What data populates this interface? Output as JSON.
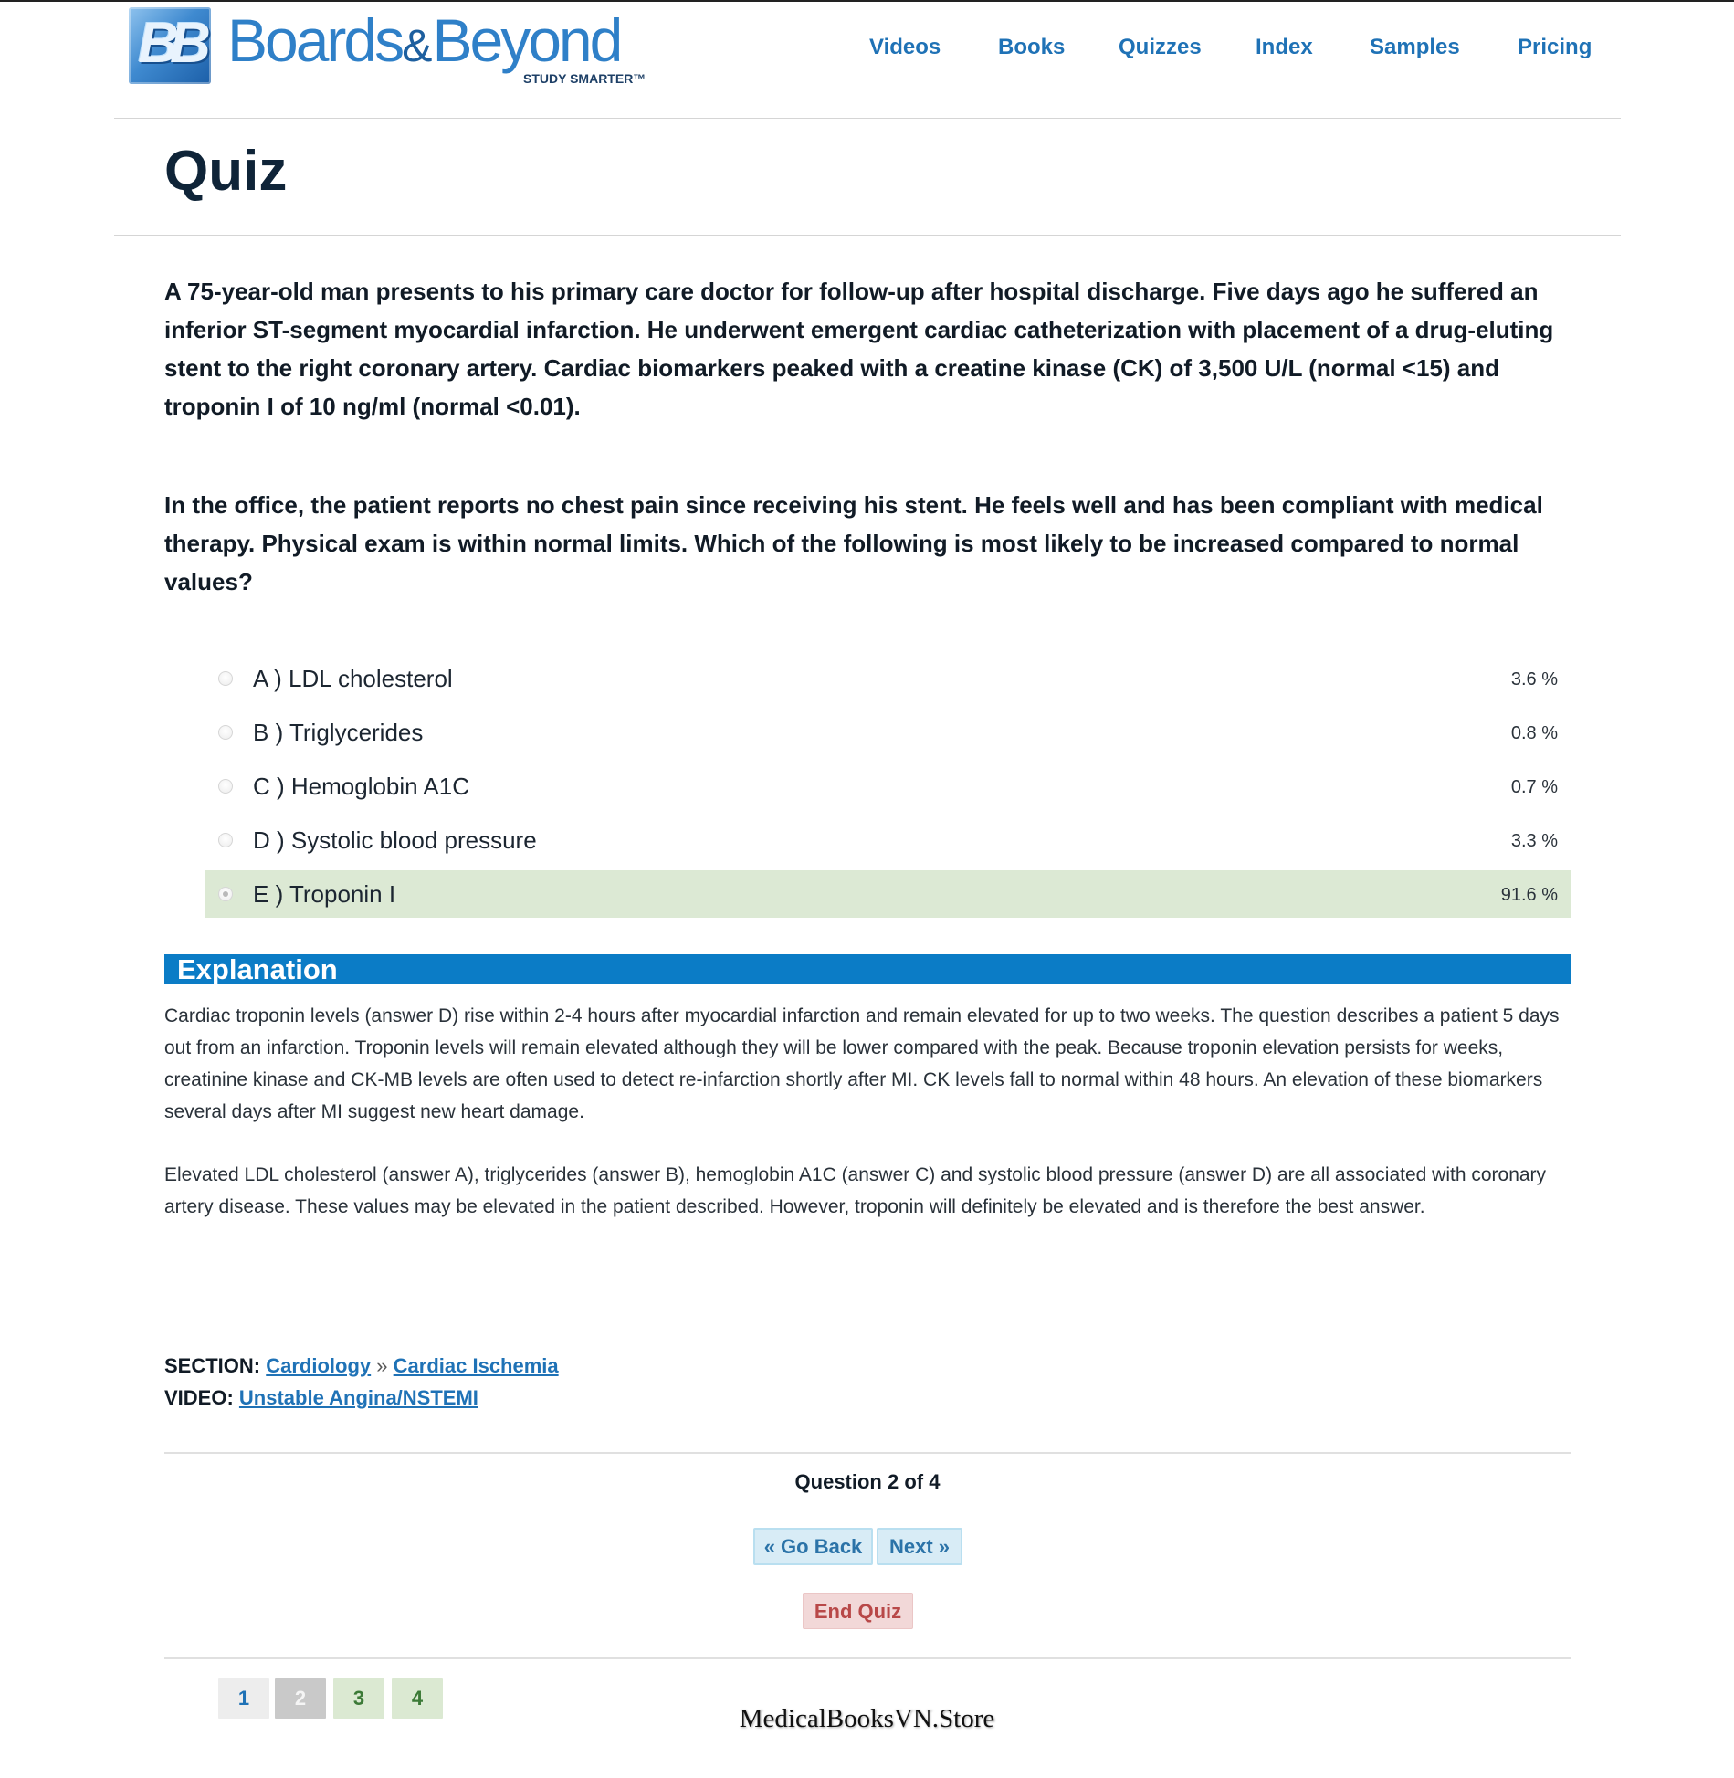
{
  "header": {
    "logo_mark": "BB",
    "logo_word": "Boards",
    "logo_amp": "&",
    "logo_word2": "Beyond",
    "logo_tagline": "STUDY SMARTER™",
    "nav": [
      "Videos",
      "Books",
      "Quizzes",
      "Index",
      "Samples",
      "Pricing"
    ]
  },
  "page": {
    "title": "Quiz"
  },
  "question": {
    "stem": "A 75-year-old man presents to his primary care doctor for follow-up after hospital discharge. Five days ago he suffered an inferior ST-segment myocardial infarction. He underwent emergent cardiac catheterization with placement of a drug-eluting stent to the right coronary artery. Cardiac biomarkers peaked with a creatine kinase (CK) of 3,500 U/L (normal <15) and troponin I of 10 ng/ml (normal <0.01).",
    "prompt": "In the office, the patient reports no chest pain since receiving his stent. He feels well and has been compliant with medical therapy. Physical exam is within normal limits. Which of the following is most likely to be increased compared to normal values?"
  },
  "answers": [
    {
      "label": "A ) LDL cholesterol",
      "percent": "3.6 %",
      "correct": false
    },
    {
      "label": "B ) Triglycerides",
      "percent": "0.8 %",
      "correct": false
    },
    {
      "label": "C ) Hemoglobin A1C",
      "percent": "0.7 %",
      "correct": false
    },
    {
      "label": "D ) Systolic blood pressure",
      "percent": "3.3 %",
      "correct": false
    },
    {
      "label": "E ) Troponin I",
      "percent": "91.6 %",
      "correct": true
    }
  ],
  "explanation": {
    "heading": "Explanation",
    "paragraphs": [
      "Cardiac troponin levels (answer D) rise within 2-4 hours after myocardial infarction and remain elevated for up to two weeks. The question describes a patient 5 days out from an infarction. Troponin levels will remain elevated although they will be lower compared with the peak. Because troponin elevation persists for weeks, creatinine kinase and CK-MB levels are often used to detect re-infarction shortly after MI. CK levels fall to normal within 48 hours. An elevation of these biomarkers several days after MI suggest new heart damage.",
      "Elevated LDL cholesterol (answer A), triglycerides (answer B), hemoglobin A1C (answer C) and systolic blood pressure (answer D) are all associated with coronary artery disease. These values may be elevated in the patient described. However, troponin will definitely be elevated and is therefore the best answer."
    ]
  },
  "meta": {
    "section_label": "SECTION:",
    "section_link": "Cardiology",
    "separator": "»",
    "subsection_link": "Cardiac Ischemia",
    "video_label": "VIDEO:",
    "video_link": "Unstable Angina/NSTEMI"
  },
  "navigation": {
    "counter": "Question 2 of 4",
    "back": "« Go Back",
    "next": "Next »",
    "end": "End Quiz",
    "pages": [
      "1",
      "2",
      "3",
      "4"
    ]
  },
  "watermark": "MedicalBooksVN.Store"
}
